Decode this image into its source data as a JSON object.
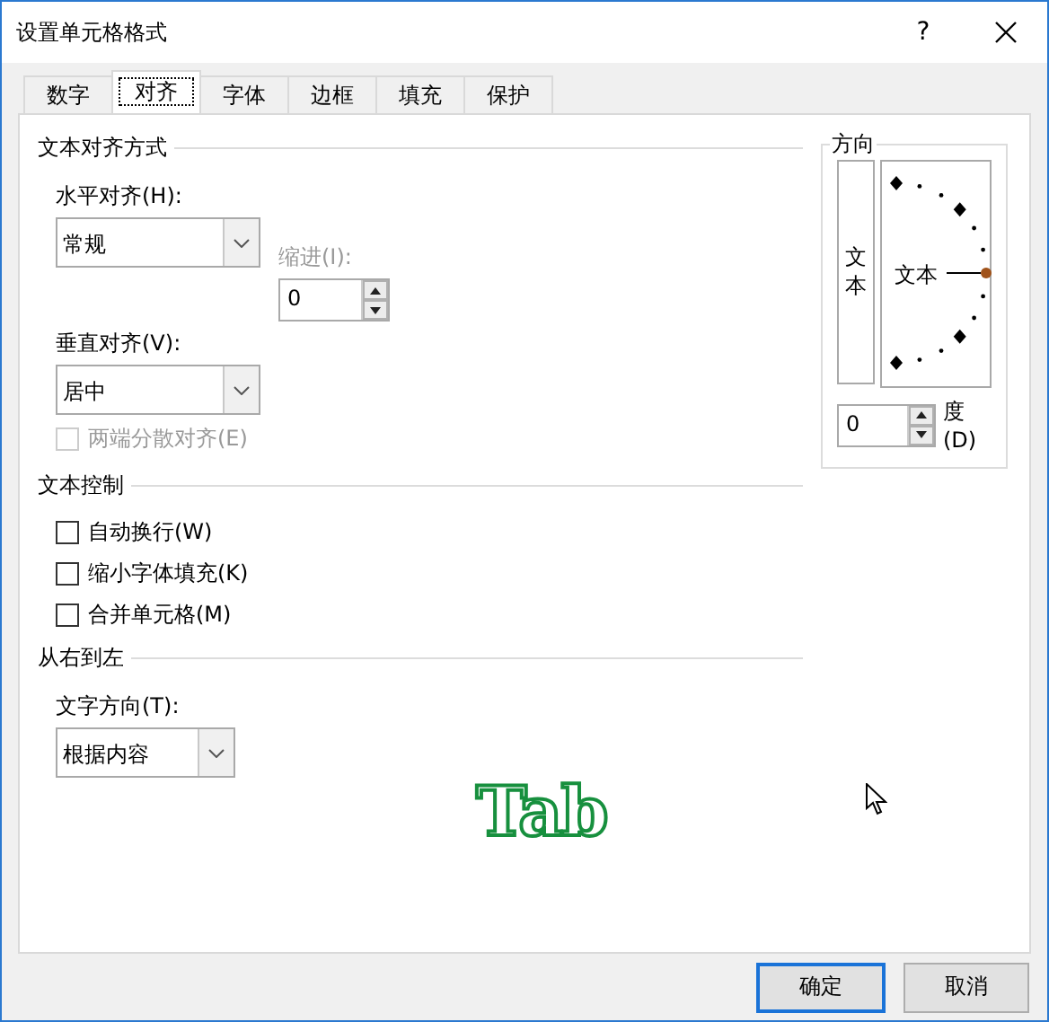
{
  "window": {
    "title": "设置单元格格式",
    "help": "?"
  },
  "tabs": [
    {
      "label": "数字",
      "selected": false
    },
    {
      "label": "对齐",
      "selected": true
    },
    {
      "label": "字体",
      "selected": false
    },
    {
      "label": "边框",
      "selected": false
    },
    {
      "label": "填充",
      "selected": false
    },
    {
      "label": "保护",
      "selected": false
    }
  ],
  "alignment": {
    "title": "文本对齐方式",
    "horizontal_label": "水平对齐(H):",
    "horizontal_value": "常规",
    "vertical_label": "垂直对齐(V):",
    "vertical_value": "居中",
    "indent_label": "缩进(I):",
    "indent_value": "0",
    "distributed": {
      "label": "两端分散对齐(E)",
      "checked": false,
      "disabled": true
    }
  },
  "text_control": {
    "title": "文本控制",
    "options": [
      {
        "label": "自动换行(W)",
        "checked": false,
        "disabled": false
      },
      {
        "label": "缩小字体填充(K)",
        "checked": false,
        "disabled": false
      },
      {
        "label": "合并单元格(M)",
        "checked": false,
        "disabled": false
      }
    ]
  },
  "rtl": {
    "title": "从右到左",
    "direction_label": "文字方向(T):",
    "direction_value": "根据内容"
  },
  "orientation": {
    "title": "方向",
    "vertical_text": "文本",
    "dial_text": "文本",
    "degrees_value": "0",
    "degrees_label": "度(D)"
  },
  "key_overlay": "Tab",
  "buttons": [
    {
      "label": "确定",
      "selected": true
    },
    {
      "label": "取消",
      "selected": false
    }
  ]
}
